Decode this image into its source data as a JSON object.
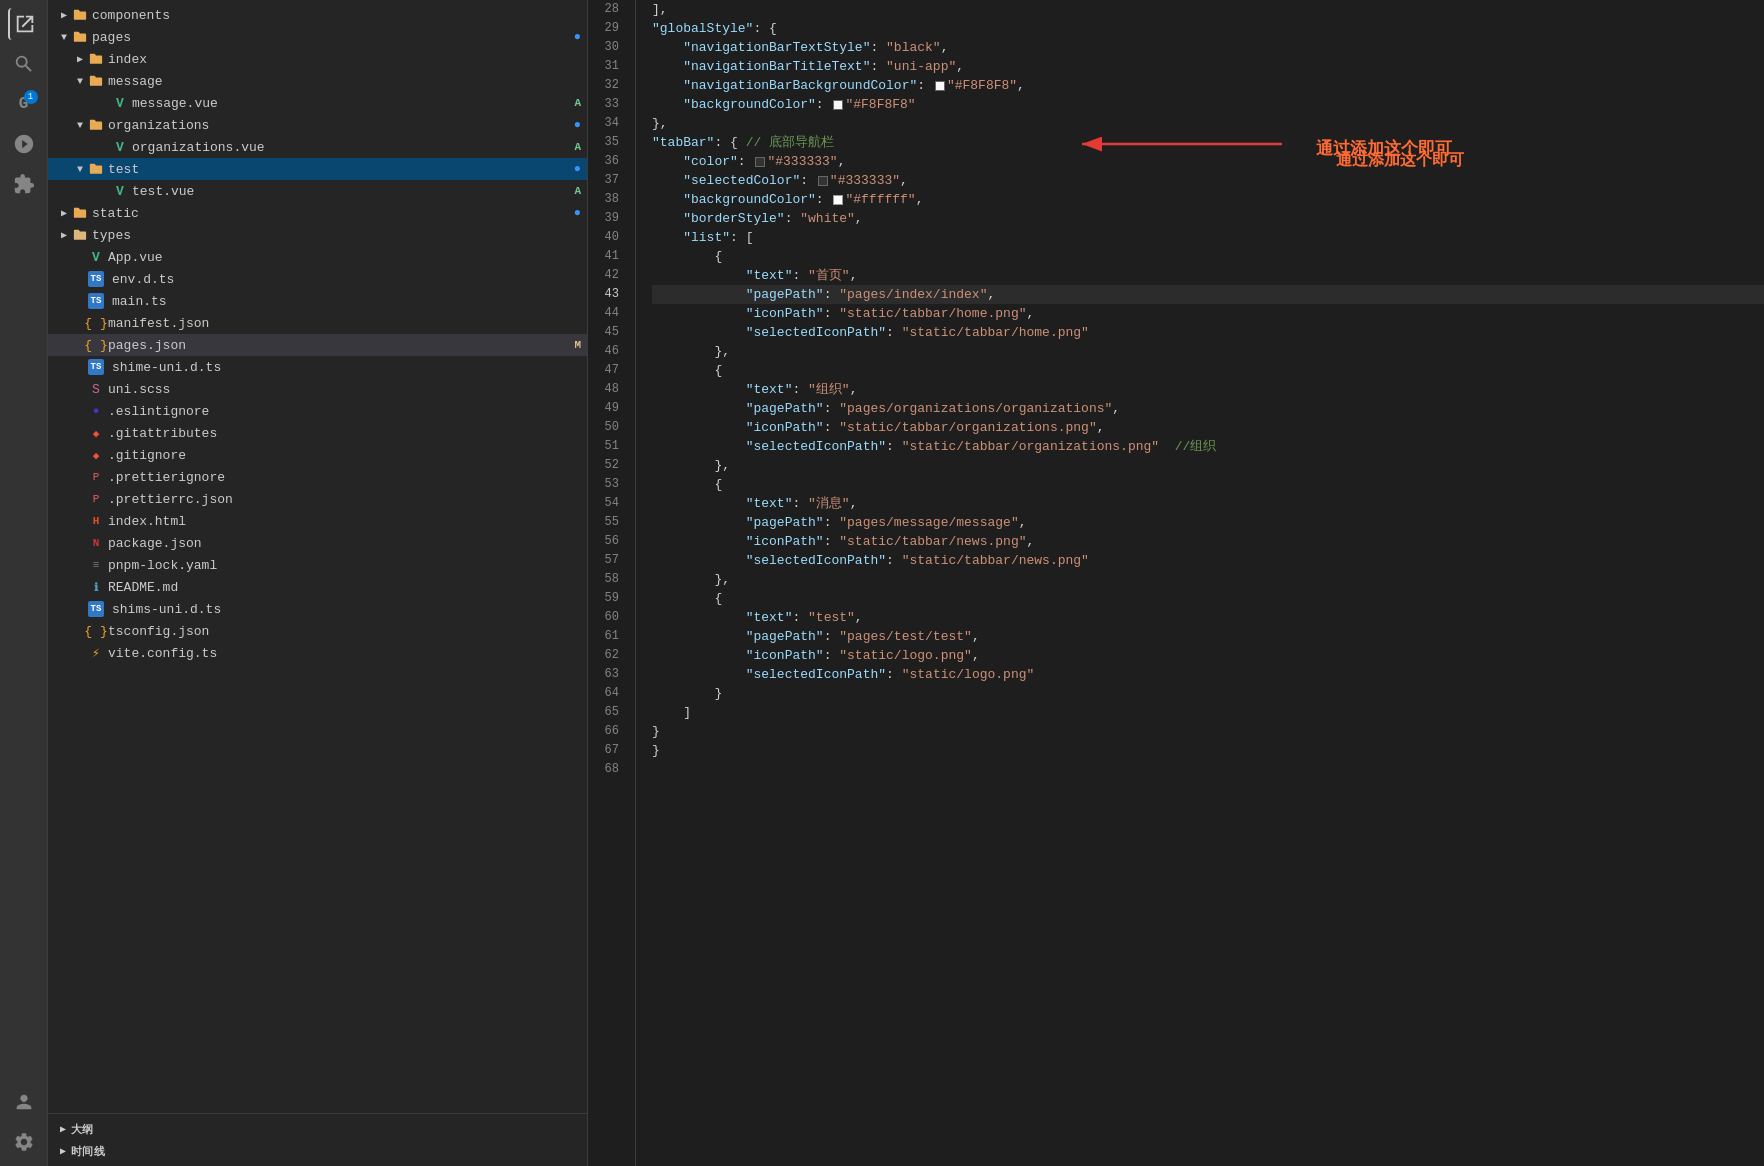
{
  "sidebar_icons": {
    "explorer": "⊞",
    "search": "🔍",
    "git": "G",
    "debug": "🌿",
    "extensions": "⬡",
    "account": "👤",
    "settings": "⚙"
  },
  "file_tree": [
    {
      "id": "components",
      "level": 1,
      "type": "folder",
      "name": "components",
      "expanded": false,
      "icon": "folder",
      "color": "#e8ab53",
      "badge": ""
    },
    {
      "id": "pages",
      "level": 1,
      "type": "folder",
      "name": "pages",
      "expanded": true,
      "icon": "folder",
      "color": "#e8ab53",
      "badge": "●",
      "badge_color": "#3794ff"
    },
    {
      "id": "index",
      "level": 2,
      "type": "folder",
      "name": "index",
      "expanded": false,
      "icon": "folder",
      "color": "#e8ab53",
      "badge": ""
    },
    {
      "id": "message",
      "level": 2,
      "type": "folder",
      "name": "message",
      "expanded": true,
      "icon": "folder",
      "color": "#e8ab53",
      "badge": ""
    },
    {
      "id": "message_vue",
      "level": 3,
      "type": "vue",
      "name": "message.vue",
      "expanded": false,
      "icon": "vue",
      "color": "#42b883",
      "badge": "A",
      "badge_color": "#73c991"
    },
    {
      "id": "organizations",
      "level": 2,
      "type": "folder",
      "name": "organizations",
      "expanded": true,
      "icon": "folder",
      "color": "#e8ab53",
      "badge": "●",
      "badge_color": "#3794ff"
    },
    {
      "id": "organizations_vue",
      "level": 3,
      "type": "vue",
      "name": "organizations.vue",
      "expanded": false,
      "icon": "vue",
      "color": "#42b883",
      "badge": "A",
      "badge_color": "#73c991"
    },
    {
      "id": "test",
      "level": 2,
      "type": "folder",
      "name": "test",
      "expanded": true,
      "icon": "folder",
      "color": "#e8ab53",
      "badge": "●",
      "badge_color": "#3794ff",
      "selected": true
    },
    {
      "id": "test_vue",
      "level": 3,
      "type": "vue",
      "name": "test.vue",
      "expanded": false,
      "icon": "vue",
      "color": "#42b883",
      "badge": "A",
      "badge_color": "#73c991"
    },
    {
      "id": "static",
      "level": 1,
      "type": "folder",
      "name": "static",
      "expanded": false,
      "icon": "folder",
      "color": "#e8ab53",
      "badge": "●",
      "badge_color": "#3794ff"
    },
    {
      "id": "types",
      "level": 1,
      "type": "folder",
      "name": "types",
      "expanded": false,
      "icon": "folder",
      "color": "#dcb67a",
      "badge": ""
    },
    {
      "id": "app_vue",
      "level": 1,
      "type": "vue",
      "name": "App.vue",
      "expanded": false,
      "icon": "vue",
      "color": "#42b883",
      "badge": ""
    },
    {
      "id": "env_d_ts",
      "level": 1,
      "type": "ts",
      "name": "env.d.ts",
      "expanded": false,
      "icon": "ts",
      "color": "#3178c6",
      "badge": ""
    },
    {
      "id": "main_ts",
      "level": 1,
      "type": "ts",
      "name": "main.ts",
      "expanded": false,
      "icon": "ts",
      "color": "#3178c6",
      "badge": ""
    },
    {
      "id": "manifest_json",
      "level": 1,
      "type": "json",
      "name": "manifest.json",
      "expanded": false,
      "icon": "json",
      "color": "#f5a623",
      "badge": ""
    },
    {
      "id": "pages_json",
      "level": 1,
      "type": "json",
      "name": "pages.json",
      "expanded": false,
      "icon": "json",
      "color": "#f5a623",
      "badge": "M",
      "badge_color": "#e2c08d",
      "active": true
    },
    {
      "id": "shime_uni_d_ts",
      "level": 1,
      "type": "ts",
      "name": "shime-uni.d.ts",
      "expanded": false,
      "icon": "ts",
      "color": "#3178c6",
      "badge": ""
    },
    {
      "id": "uni_scss",
      "level": 1,
      "type": "scss",
      "name": "uni.scss",
      "expanded": false,
      "icon": "scss",
      "color": "#cc6699",
      "badge": ""
    },
    {
      "id": "eslintignore",
      "level": 1,
      "type": "config",
      "name": ".eslintignore",
      "expanded": false,
      "icon": "eslint",
      "color": "#4b32c3",
      "badge": ""
    },
    {
      "id": "gitattributes",
      "level": 1,
      "type": "git",
      "name": ".gitattributes",
      "expanded": false,
      "icon": "git",
      "color": "#f05033",
      "badge": ""
    },
    {
      "id": "gitignore",
      "level": 1,
      "type": "git",
      "name": ".gitignore",
      "expanded": false,
      "icon": "git",
      "color": "#f05033",
      "badge": ""
    },
    {
      "id": "prettierignore",
      "level": 1,
      "type": "config",
      "name": ".prettierignore",
      "expanded": false,
      "icon": "prettier",
      "color": "#ea5e5e",
      "badge": ""
    },
    {
      "id": "prettierrc_json",
      "level": 1,
      "type": "json",
      "name": ".prettierrc.json",
      "expanded": false,
      "icon": "json",
      "color": "#ea5e5e",
      "badge": ""
    },
    {
      "id": "index_html",
      "level": 1,
      "type": "html",
      "name": "index.html",
      "expanded": false,
      "icon": "html",
      "color": "#e34c26",
      "badge": ""
    },
    {
      "id": "package_json",
      "level": 1,
      "type": "json",
      "name": "package.json",
      "expanded": false,
      "icon": "npm",
      "color": "#cc3534",
      "badge": ""
    },
    {
      "id": "pnpm_lock_yaml",
      "level": 1,
      "type": "yaml",
      "name": "pnpm-lock.yaml",
      "expanded": false,
      "icon": "yaml",
      "color": "#6b7a8d",
      "badge": ""
    },
    {
      "id": "readme_md",
      "level": 1,
      "type": "md",
      "name": "README.md",
      "expanded": false,
      "icon": "md",
      "color": "#519aba",
      "badge": ""
    },
    {
      "id": "shims_uni_d_ts",
      "level": 1,
      "type": "ts",
      "name": "shims-uni.d.ts",
      "expanded": false,
      "icon": "ts",
      "color": "#3178c6",
      "badge": ""
    },
    {
      "id": "tsconfig_json",
      "level": 1,
      "type": "json",
      "name": "tsconfig.json",
      "expanded": false,
      "icon": "json",
      "color": "#f5a623",
      "badge": ""
    },
    {
      "id": "vite_config_ts",
      "level": 1,
      "type": "ts",
      "name": "vite.config.ts",
      "expanded": false,
      "icon": "vite",
      "color": "#f5a623",
      "badge": ""
    }
  ],
  "bottom_panels": [
    {
      "id": "outline",
      "label": "大纲",
      "expanded": false
    },
    {
      "id": "timeline",
      "label": "时间线",
      "expanded": false
    }
  ],
  "code_lines": [
    {
      "num": 28,
      "content": "],"
    },
    {
      "num": 29,
      "content": "\"globalStyle\": {"
    },
    {
      "num": 30,
      "content": "    \"navigationBarTextStyle\": \"black\","
    },
    {
      "num": 31,
      "content": "    \"navigationBarTitleText\": \"uni-app\","
    },
    {
      "num": 32,
      "content": "    \"navigationBarBackgroundColor\": \"#F8F8F8\","
    },
    {
      "num": 33,
      "content": "    \"backgroundColor\": \"#F8F8F8\""
    },
    {
      "num": 34,
      "content": "},"
    },
    {
      "num": 35,
      "content": "\"tabBar\": { // 底部导航栏"
    },
    {
      "num": 36,
      "content": "    \"color\": \"#333333\","
    },
    {
      "num": 37,
      "content": "    \"selectedColor\": \"#333333\","
    },
    {
      "num": 38,
      "content": "    \"backgroundColor\": \"#ffffff\","
    },
    {
      "num": 39,
      "content": "    \"borderStyle\": \"white\","
    },
    {
      "num": 40,
      "content": "    \"list\": ["
    },
    {
      "num": 41,
      "content": "        {"
    },
    {
      "num": 42,
      "content": "            \"text\": \"首页\","
    },
    {
      "num": 43,
      "content": "            \"pagePath\": \"pages/index/index\","
    },
    {
      "num": 44,
      "content": "            \"iconPath\": \"static/tabbar/home.png\","
    },
    {
      "num": 45,
      "content": "            \"selectedIconPath\": \"static/tabbar/home.png\""
    },
    {
      "num": 46,
      "content": "        },"
    },
    {
      "num": 47,
      "content": "        {"
    },
    {
      "num": 48,
      "content": "            \"text\": \"组织\","
    },
    {
      "num": 49,
      "content": "            \"pagePath\": \"pages/organizations/organizations\","
    },
    {
      "num": 50,
      "content": "            \"iconPath\": \"static/tabbar/organizations.png\","
    },
    {
      "num": 51,
      "content": "            \"selectedIconPath\": \"static/tabbar/organizations.png\"  //组织"
    },
    {
      "num": 52,
      "content": "        },"
    },
    {
      "num": 53,
      "content": "        {"
    },
    {
      "num": 54,
      "content": "            \"text\": \"消息\","
    },
    {
      "num": 55,
      "content": "            \"pagePath\": \"pages/message/message\","
    },
    {
      "num": 56,
      "content": "            \"iconPath\": \"static/tabbar/news.png\","
    },
    {
      "num": 57,
      "content": "            \"selectedIconPath\": \"static/tabbar/news.png\""
    },
    {
      "num": 58,
      "content": "        },"
    },
    {
      "num": 59,
      "content": "        {"
    },
    {
      "num": 60,
      "content": "            \"text\": \"test\","
    },
    {
      "num": 61,
      "content": "            \"pagePath\": \"pages/test/test\","
    },
    {
      "num": 62,
      "content": "            \"iconPath\": \"static/logo.png\","
    },
    {
      "num": 63,
      "content": "            \"selectedIconPath\": \"static/logo.png\""
    },
    {
      "num": 64,
      "content": "        }"
    },
    {
      "num": 65,
      "content": "    ]"
    },
    {
      "num": 66,
      "content": "}"
    },
    {
      "num": 67,
      "content": "}"
    },
    {
      "num": 68,
      "content": ""
    }
  ],
  "annotation": {
    "arrow_text": "←",
    "comment_text": "通过添加这个即可"
  },
  "current_line": 43
}
